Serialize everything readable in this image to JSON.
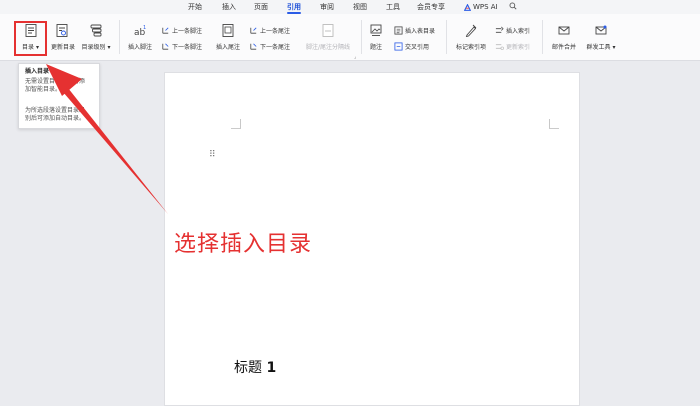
{
  "tabs": [
    {
      "label": "开始",
      "active": false
    },
    {
      "label": "插入",
      "active": false
    },
    {
      "label": "页面",
      "active": false
    },
    {
      "label": "引用",
      "active": true
    },
    {
      "label": "审阅",
      "active": false
    },
    {
      "label": "视图",
      "active": false
    },
    {
      "label": "工具",
      "active": false
    },
    {
      "label": "会员专享",
      "active": false
    }
  ],
  "wps_ai": "WPS AI",
  "ribbon": {
    "toc": "目录",
    "update_toc": "更新目录",
    "toc_level": "目录级别",
    "insert_footnote": "插入脚注",
    "prev_footnote": "上一条脚注",
    "next_footnote": "下一条脚注",
    "insert_endnote": "插入尾注",
    "prev_endnote": "上一条尾注",
    "next_endnote": "下一条尾注",
    "separator_line": "脚注/尾注分隔线",
    "caption": "题注",
    "insert_table_of_figures": "插入表目录",
    "cross_reference": "交叉引用",
    "mark_index_entry": "标记索引项",
    "insert_index": "插入索引",
    "update_index": "更新索引",
    "mail_merge": "邮件合并",
    "bulk_tools": "群发工具"
  },
  "dropdown": {
    "title": "插入目录",
    "line1": "无需设置目录，即可添",
    "line2": "加智能目录。",
    "line3": "为所选段落设置目录级",
    "line4": "别后可添加自动目录。"
  },
  "document": {
    "heading_text": "标题",
    "heading_number": "1"
  },
  "annotation": {
    "text": "选择插入目录",
    "color": "#e53131"
  },
  "colors": {
    "accent": "#2b5ce6",
    "highlight": "#e53131"
  }
}
